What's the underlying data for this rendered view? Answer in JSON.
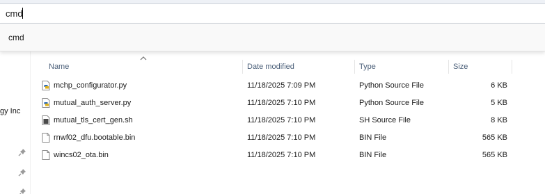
{
  "address_bar": {
    "value": "cmd"
  },
  "suggestions": [
    {
      "label": "cmd"
    }
  ],
  "nav": {
    "partial_label": "gy Inc"
  },
  "columns": {
    "name": "Name",
    "date_modified": "Date modified",
    "type": "Type",
    "size": "Size"
  },
  "files": [
    {
      "name": "mchp_configurator.py",
      "date": "11/18/2025 7:09 PM",
      "type": "Python Source File",
      "size": "6 KB",
      "icon": "python-file-icon"
    },
    {
      "name": "mutual_auth_server.py",
      "date": "11/18/2025 7:10 PM",
      "type": "Python Source File",
      "size": "5 KB",
      "icon": "python-file-icon"
    },
    {
      "name": "mutual_tls_cert_gen.sh",
      "date": "11/18/2025 7:10 PM",
      "type": "SH Source File",
      "size": "8 KB",
      "icon": "shell-script-icon"
    },
    {
      "name": "rnwf02_dfu.bootable.bin",
      "date": "11/18/2025 7:10 PM",
      "type": "BIN File",
      "size": "565 KB",
      "icon": "generic-file-icon"
    },
    {
      "name": "wincs02_ota.bin",
      "date": "11/18/2025 7:10 PM",
      "type": "BIN File",
      "size": "565 KB",
      "icon": "generic-file-icon"
    }
  ],
  "colors": {
    "header_text": "#4c607a",
    "python_icon": "#2f6db5",
    "shell_icon": "#4a4a4a"
  }
}
